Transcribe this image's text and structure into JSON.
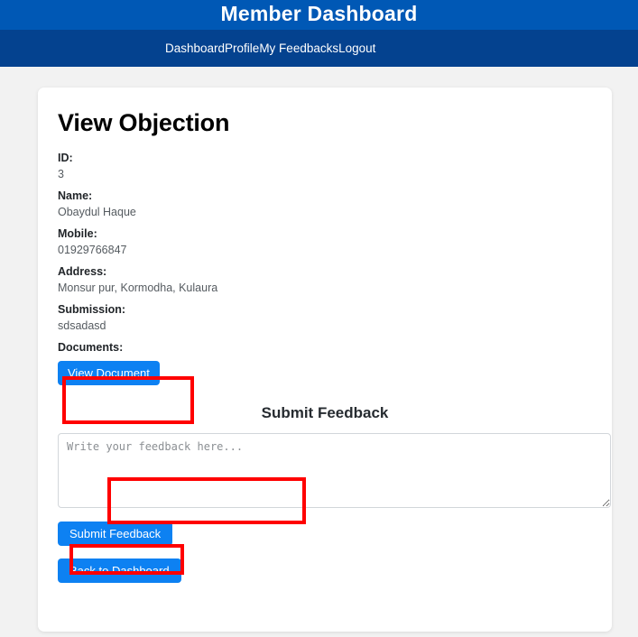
{
  "header": {
    "title": "Member Dashboard",
    "brand_color": "#0058b5"
  },
  "nav": {
    "background_color": "#04428f",
    "items": [
      {
        "label": "Dashboard"
      },
      {
        "label": "Profile"
      },
      {
        "label": "My Feedbacks"
      },
      {
        "label": "Logout"
      }
    ]
  },
  "main": {
    "page_title": "View Objection",
    "fields": [
      {
        "label": "ID:",
        "value": "3"
      },
      {
        "label": "Name:",
        "value": "Obaydul Haque"
      },
      {
        "label": "Mobile:",
        "value": "01929766847"
      },
      {
        "label": "Address:",
        "value": "Monsur pur, Kormodha, Kulaura"
      },
      {
        "label": "Submission:",
        "value": "sdsadasd"
      },
      {
        "label": "Documents:",
        "value": ""
      }
    ],
    "view_document_button": "View Document",
    "feedback": {
      "heading": "Submit Feedback",
      "textarea_placeholder": "Write your feedback here...",
      "textarea_value": "",
      "submit_button": "Submit Feedback"
    },
    "back_button": "Back to Dashboard",
    "button_color": "#0d81f2"
  },
  "annotations": {
    "color": "#ff0000",
    "boxes": [
      {
        "target": "view-document-button"
      },
      {
        "target": "feedback-textarea"
      },
      {
        "target": "submit-feedback-button"
      }
    ]
  }
}
